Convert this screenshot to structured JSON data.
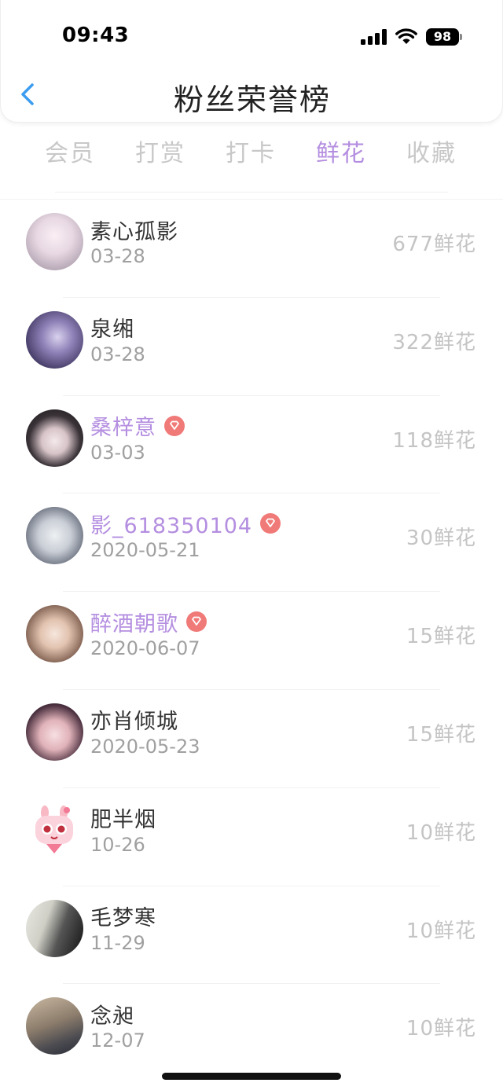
{
  "status_bar": {
    "time": "09:43",
    "battery": "98"
  },
  "header": {
    "title": "粉丝荣誉榜"
  },
  "tabs": [
    {
      "label": "会员",
      "active": false
    },
    {
      "label": "打赏",
      "active": false
    },
    {
      "label": "打卡",
      "active": false
    },
    {
      "label": "鲜花",
      "active": true
    },
    {
      "label": "收藏",
      "active": false
    }
  ],
  "colors": {
    "accent": "#b48ee0",
    "back_arrow": "#3b9cf0",
    "vip_badge": "#f07a78",
    "inactive_tab": "#c8c8c8"
  },
  "fans": [
    {
      "name": "素心孤影",
      "date": "03-28",
      "count": "677鲜花",
      "vip": false
    },
    {
      "name": "泉缃",
      "date": "03-28",
      "count": "322鲜花",
      "vip": false
    },
    {
      "name": "桑梓意",
      "date": "03-03",
      "count": "118鲜花",
      "vip": true
    },
    {
      "name": "影_618350104",
      "date": "2020-05-21",
      "count": "30鲜花",
      "vip": true
    },
    {
      "name": "醉酒朝歌",
      "date": "2020-06-07",
      "count": "15鲜花",
      "vip": true
    },
    {
      "name": "亦肖倾城",
      "date": "2020-05-23",
      "count": "15鲜花",
      "vip": false
    },
    {
      "name": "肥半烟",
      "date": "10-26",
      "count": "10鲜花",
      "vip": false
    },
    {
      "name": "毛梦寒",
      "date": "11-29",
      "count": "10鲜花",
      "vip": false
    },
    {
      "name": "念昶",
      "date": "12-07",
      "count": "10鲜花",
      "vip": false
    }
  ]
}
